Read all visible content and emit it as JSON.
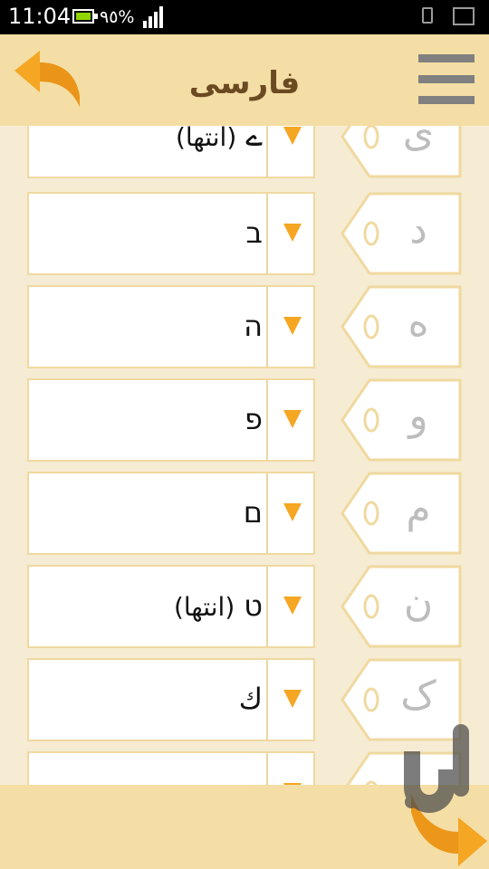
{
  "status": {
    "time": "11:04",
    "battery": "٩٥%",
    "battery_color": "#8ed400"
  },
  "header": {
    "title": "فارسی",
    "back_icon": "curved-back-arrow-icon",
    "menu_icon": "hamburger-menu-icon"
  },
  "rows": [
    {
      "letter": "ی",
      "value": "ے",
      "suffix": "(انتها)"
    },
    {
      "letter": "د",
      "value": "ב",
      "suffix": ""
    },
    {
      "letter": "ه",
      "value": "ה",
      "suffix": ""
    },
    {
      "letter": "و",
      "value": "פ",
      "suffix": ""
    },
    {
      "letter": "م",
      "value": "ם",
      "suffix": ""
    },
    {
      "letter": "ن",
      "value": "ט",
      "suffix": "(انتها)"
    },
    {
      "letter": "ک",
      "value": "ك",
      "suffix": ""
    },
    {
      "letter": "",
      "value": "",
      "suffix": ""
    }
  ],
  "footer": {
    "next_icon": "curved-forward-arrow-icon",
    "watermark_icon": "cafe-bazaar-logo-icon"
  },
  "colors": {
    "accent": "#f5a623",
    "header_bg": "#f4dea5",
    "list_bg": "#f6ecd3",
    "border": "#f0d9a0",
    "title": "#6b4a22"
  }
}
